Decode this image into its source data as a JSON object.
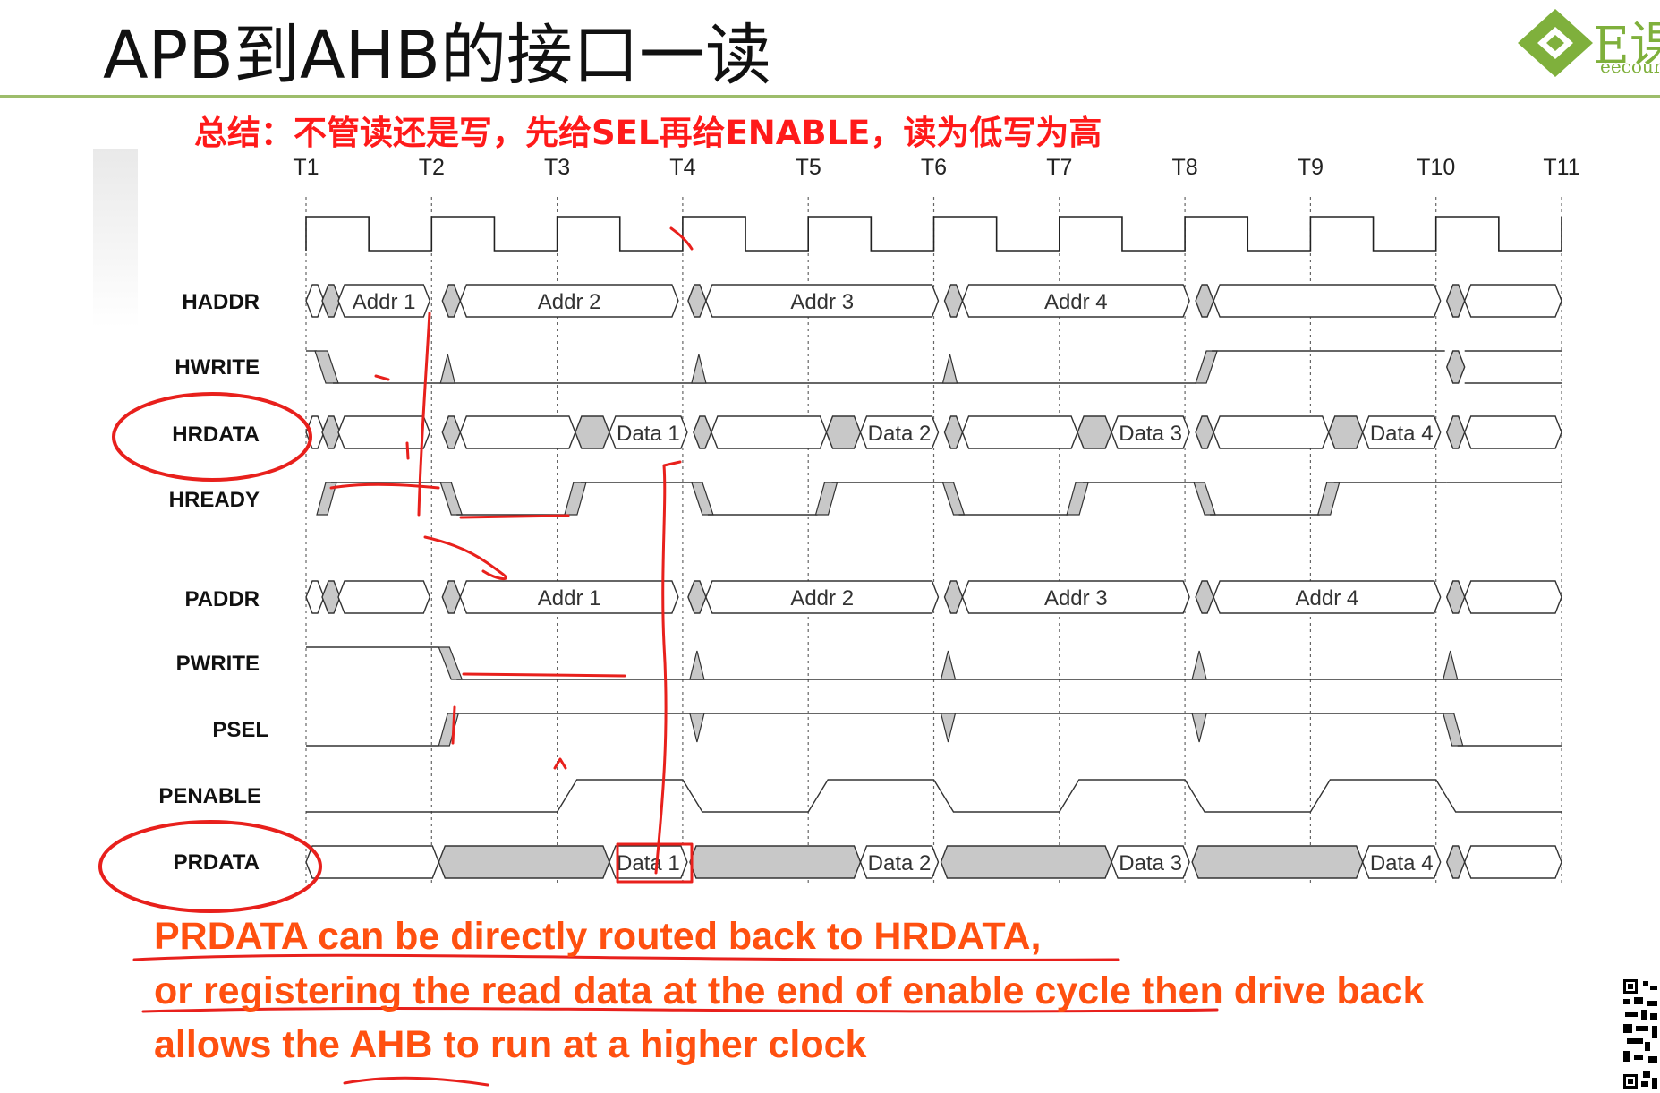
{
  "title": "APB到AHB的接口一读",
  "summary": "总结：不管读还是写，先给SEL再给ENABLE，读为低写为高",
  "notes": [
    "PRDATA can be directly routed back to HRDATA,",
    "or registering the read data at the end of enable cycle then drive back",
    "allows the AHB to run at a higher clock"
  ],
  "timing": {
    "cycles": [
      "T1",
      "T2",
      "T3",
      "T4",
      "T5",
      "T6",
      "T7",
      "T8",
      "T9",
      "T10",
      "T11"
    ],
    "signals": {
      "haddr": {
        "name": "HADDR",
        "values": [
          "Addr 1",
          "Addr 2",
          "Addr 3",
          "Addr 4"
        ]
      },
      "hwrite": {
        "name": "HWRITE"
      },
      "hrdata": {
        "name": "HRDATA",
        "values": [
          "Data 1",
          "Data 2",
          "Data 3",
          "Data 4"
        ]
      },
      "hready": {
        "name": "HREADY"
      },
      "paddr": {
        "name": "PADDR",
        "values": [
          "Addr 1",
          "Addr 2",
          "Addr 3",
          "Addr 4"
        ]
      },
      "pwrite": {
        "name": "PWRITE"
      },
      "psel": {
        "name": "PSEL"
      },
      "penable": {
        "name": "PENABLE"
      },
      "prdata": {
        "name": "PRDATA",
        "values": [
          "Data 1",
          "Data 2",
          "Data 3",
          "Data 4"
        ]
      }
    }
  },
  "colors": {
    "summary": "#ff1a1a",
    "note": "#ff5010",
    "annotation": "#e8201c",
    "hatch": "#c8c8c8",
    "rule": "#9dbd6b"
  }
}
